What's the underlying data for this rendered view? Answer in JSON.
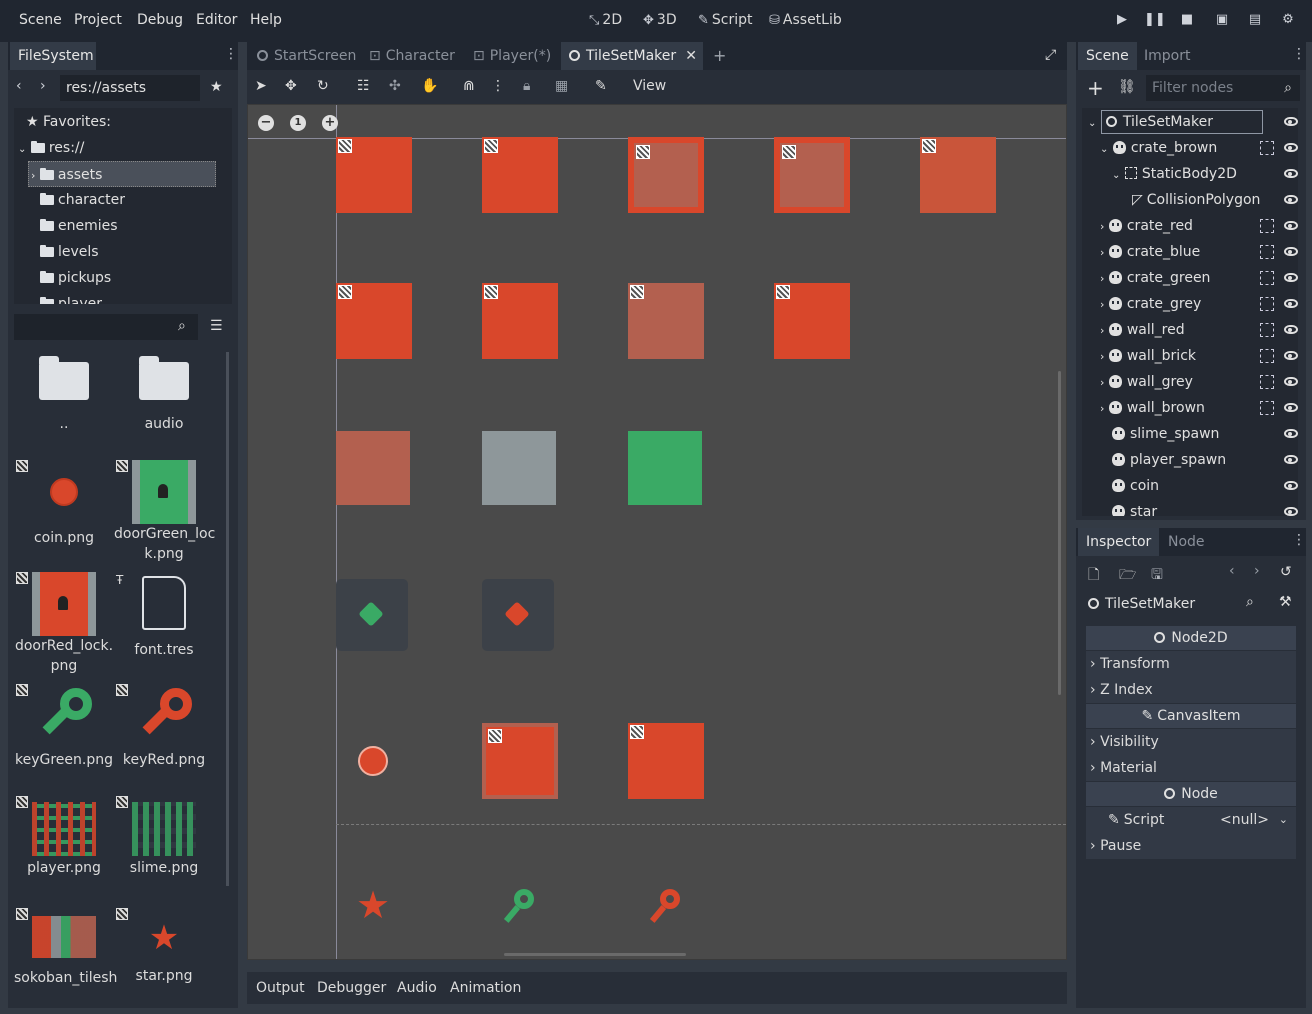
{
  "menu": [
    "Scene",
    "Project",
    "Debug",
    "Editor",
    "Help"
  ],
  "workspaces": [
    {
      "icon": "2d-icon",
      "glyph": "⤡",
      "label": "2D"
    },
    {
      "icon": "3d-icon",
      "glyph": "✥",
      "label": "3D"
    },
    {
      "icon": "script-icon",
      "glyph": "✎",
      "label": "Script"
    },
    {
      "icon": "assetlib-icon",
      "glyph": "⛁",
      "label": "AssetLib"
    }
  ],
  "filesystem": {
    "tab": "FileSystem",
    "path": "res://assets",
    "favorites": "Favorites:",
    "root": "res://",
    "tree": [
      "assets",
      "character",
      "enemies",
      "levels",
      "pickups",
      "player"
    ],
    "files": [
      {
        "name": "..",
        "type": "folder"
      },
      {
        "name": "audio",
        "type": "folder"
      },
      {
        "name": "coin.png",
        "type": "coin"
      },
      {
        "name": "doorGreen_lock.png",
        "line1": "doorGreen_loc",
        "line2": "k.png",
        "type": "door-green"
      },
      {
        "name": "doorRed_lock.png",
        "line1": "doorRed_lock.",
        "line2": "png",
        "type": "door-red"
      },
      {
        "name": "font.tres",
        "type": "doc"
      },
      {
        "name": "keyGreen.png",
        "type": "key-green"
      },
      {
        "name": "keyRed.png",
        "type": "key-red"
      },
      {
        "name": "player.png",
        "type": "sheet"
      },
      {
        "name": "slime.png",
        "type": "sheet2"
      },
      {
        "name": "sokoban_tilesh",
        "type": "sheet3"
      },
      {
        "name": "star.png",
        "type": "star"
      }
    ]
  },
  "editor_tabs": [
    {
      "label": "StartScreen",
      "active": false
    },
    {
      "label": "Character",
      "active": false
    },
    {
      "label": "Player(*)",
      "active": false
    },
    {
      "label": "TileSetMaker",
      "active": true
    }
  ],
  "toolbar": {
    "view": "View"
  },
  "zoom": {
    "minus": "−",
    "reset": "1",
    "plus": "+"
  },
  "scene_panel": {
    "tabs": [
      "Scene",
      "Import"
    ],
    "filter_placeholder": "Filter nodes",
    "nodes": [
      {
        "label": "TileSetMaker",
        "indent": 0,
        "icon": "node2d"
      },
      {
        "label": "crate_brown",
        "indent": 1,
        "icon": "sprite",
        "group": true
      },
      {
        "label": "StaticBody2D",
        "indent": 2,
        "icon": "body"
      },
      {
        "label": "CollisionPolygon",
        "indent": 3,
        "icon": "poly"
      },
      {
        "label": "crate_red",
        "indent": 1,
        "icon": "sprite",
        "group": true
      },
      {
        "label": "crate_blue",
        "indent": 1,
        "icon": "sprite",
        "group": true
      },
      {
        "label": "crate_green",
        "indent": 1,
        "icon": "sprite",
        "group": true
      },
      {
        "label": "crate_grey",
        "indent": 1,
        "icon": "sprite",
        "group": true
      },
      {
        "label": "wall_red",
        "indent": 1,
        "icon": "sprite",
        "group": true
      },
      {
        "label": "wall_brick",
        "indent": 1,
        "icon": "sprite",
        "group": true
      },
      {
        "label": "wall_grey",
        "indent": 1,
        "icon": "sprite",
        "group": true
      },
      {
        "label": "wall_brown",
        "indent": 1,
        "icon": "sprite",
        "group": true
      },
      {
        "label": "slime_spawn",
        "indent": 1,
        "icon": "sprite",
        "group": false
      },
      {
        "label": "player_spawn",
        "indent": 1,
        "icon": "sprite",
        "group": false
      },
      {
        "label": "coin",
        "indent": 1,
        "icon": "sprite",
        "group": false
      },
      {
        "label": "star",
        "indent": 1,
        "icon": "sprite",
        "group": false
      }
    ]
  },
  "inspector": {
    "tabs": [
      "Inspector",
      "Node"
    ],
    "object": "TileSetMaker",
    "sections": [
      {
        "kind": "header",
        "label": "Node2D"
      },
      {
        "kind": "row",
        "label": "Transform"
      },
      {
        "kind": "row",
        "label": "Z Index"
      },
      {
        "kind": "header",
        "label": "CanvasItem"
      },
      {
        "kind": "row",
        "label": "Visibility"
      },
      {
        "kind": "row",
        "label": "Material"
      },
      {
        "kind": "header",
        "label": "Node"
      },
      {
        "kind": "prop",
        "label": "Script",
        "value": "<null>"
      },
      {
        "kind": "row",
        "label": "Pause"
      }
    ]
  },
  "bottom_panel": [
    "Output",
    "Debugger",
    "Audio",
    "Animation"
  ],
  "colors": {
    "red": "#d9472b",
    "brown_red": "#b3604f",
    "grey": "#8e979a",
    "green": "#3aaa65",
    "dark": "#3c4148"
  }
}
